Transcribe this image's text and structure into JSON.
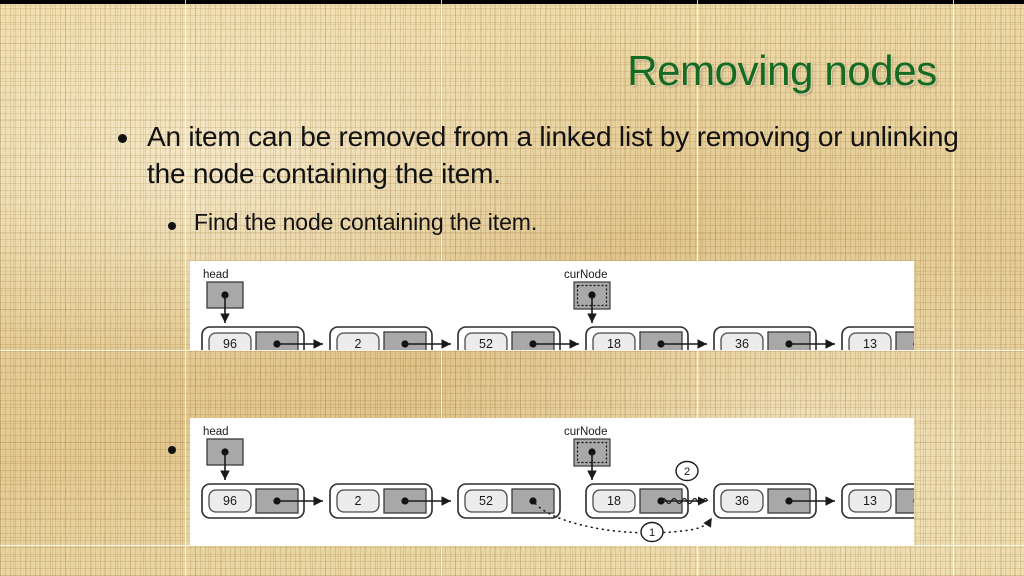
{
  "slide": {
    "title": "Removing nodes",
    "title_color": "#156b21",
    "background_color": "#e9d49a",
    "bullets": [
      {
        "level": 1,
        "text": "An item can be removed from a linked list by removing or unlinking the node containing the item."
      },
      {
        "level": 2,
        "text": "Find the node containing the item."
      }
    ],
    "second_bullet_marker": "•"
  },
  "diagram1": {
    "caption_head": "head",
    "caption_curnode": "curNode",
    "nodes": [
      {
        "value": "96"
      },
      {
        "value": "2"
      },
      {
        "value": "52"
      },
      {
        "value": "18"
      },
      {
        "value": "36"
      },
      {
        "value": "13"
      }
    ],
    "curnode_points_to": "18",
    "head_points_to": "96"
  },
  "diagram2": {
    "caption_head": "head",
    "caption_curnode": "curNode",
    "nodes": [
      {
        "value": "96"
      },
      {
        "value": "2"
      },
      {
        "value": "52"
      },
      {
        "value": "18"
      },
      {
        "value": "36"
      },
      {
        "value": "13"
      }
    ],
    "curnode_points_to": "18",
    "head_points_to": "96",
    "step_labels": [
      {
        "id": "1",
        "text": "1",
        "meaning": "new-link-52-to-36"
      },
      {
        "id": "2",
        "text": "2",
        "meaning": "severed-link-18-to-36"
      }
    ]
  }
}
